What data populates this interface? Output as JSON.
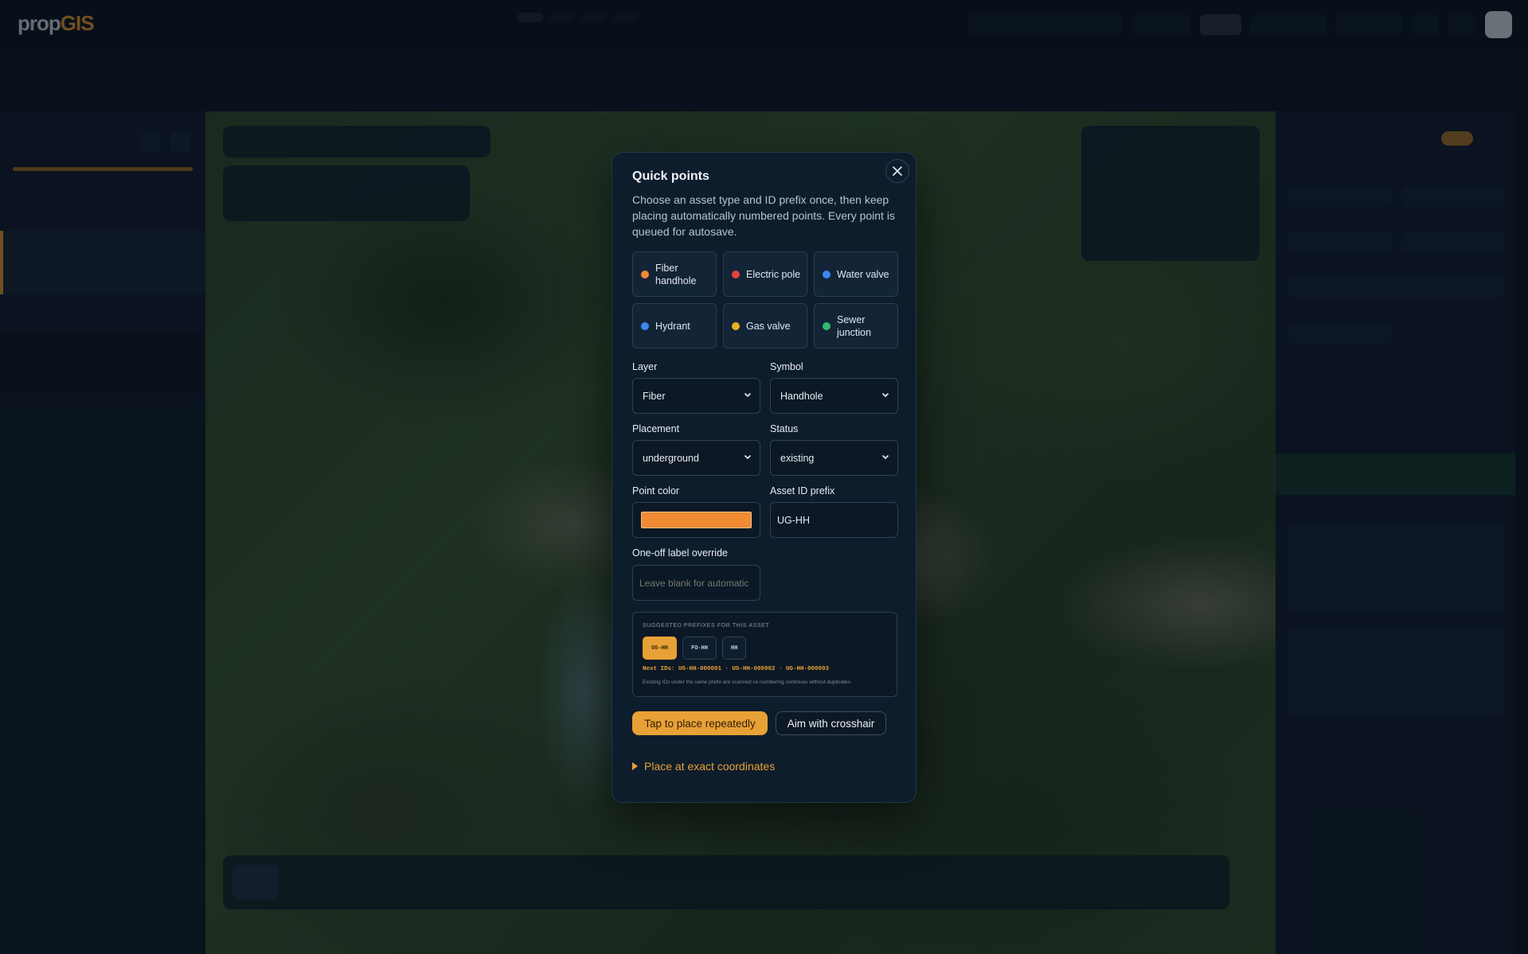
{
  "modal": {
    "title": "Quick points",
    "description": "Choose an asset type and ID prefix once, then keep placing automatically numbered points. Every point is queued for autosave.",
    "asset_types": [
      {
        "label": "Fiber handhole",
        "color": "#f08a33"
      },
      {
        "label": "Electric pole",
        "color": "#e0443b"
      },
      {
        "label": "Water valve",
        "color": "#3d85f0"
      },
      {
        "label": "Hydrant",
        "color": "#3d85f0"
      },
      {
        "label": "Gas valve",
        "color": "#eab023"
      },
      {
        "label": "Sewer junction",
        "color": "#2dba6e"
      }
    ],
    "layer": {
      "label": "Layer",
      "value": "Fiber"
    },
    "symbol": {
      "label": "Symbol",
      "value": "Handhole"
    },
    "placement": {
      "label": "Placement",
      "value": "underground"
    },
    "status": {
      "label": "Status",
      "value": "existing"
    },
    "point_color": {
      "label": "Point color",
      "value": "#f08a33"
    },
    "asset_id_prefix": {
      "label": "Asset ID prefix",
      "value": "UG-HH"
    },
    "label_override": {
      "label": "One-off label override",
      "placeholder": "Leave blank for automatic"
    },
    "suggested": {
      "title": "SUGGESTED PREFIXES FOR THIS ASSET",
      "prefixes": [
        "UG-HH",
        "FO-HH",
        "HH"
      ],
      "selected": "UG-HH",
      "next_ids": "Next IDs: UG-HH-000001 · UG-HH-000002 · UG-HH-000003",
      "note": "Existing IDs under the same prefix are scanned so numbering continues without duplicates."
    },
    "primary_button": "Tap to place repeatedly",
    "secondary_button": "Aim with crosshair",
    "details_label": "Place at exact coordinates"
  },
  "colors": {
    "accent": "#e8a136",
    "modal_bg": "#0e1d2c"
  },
  "icons": {
    "close": "close-icon",
    "select_chevron": "chevron-down-icon",
    "disclosure": "triangle-right-icon"
  }
}
